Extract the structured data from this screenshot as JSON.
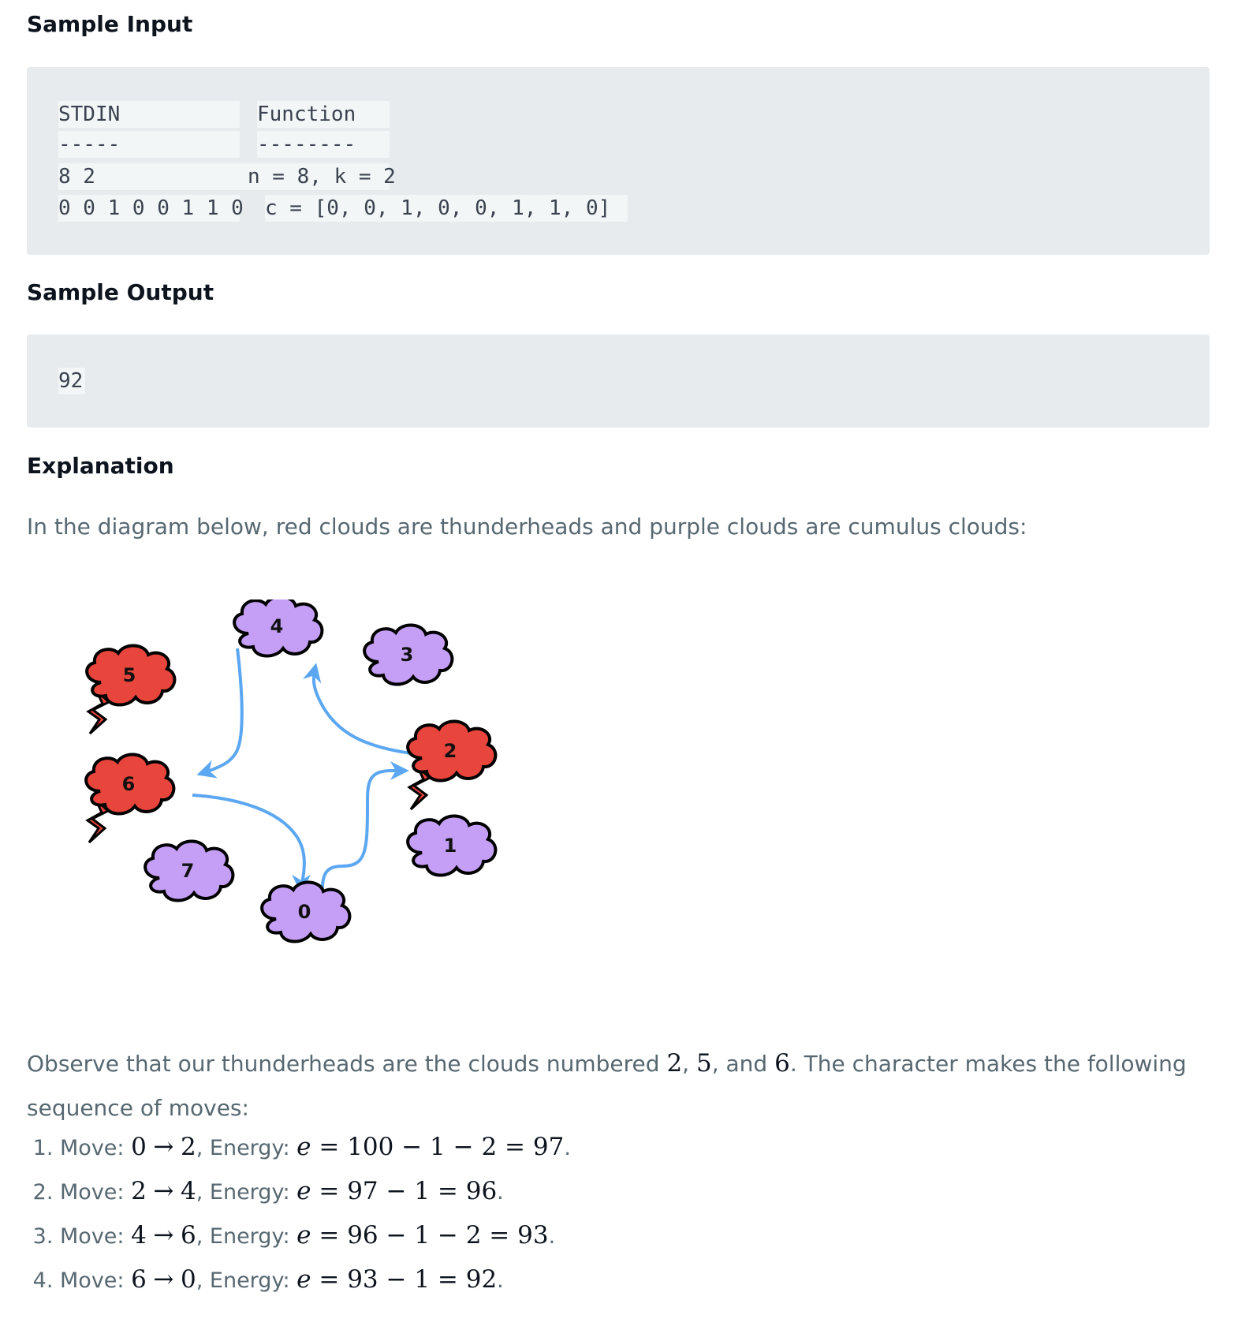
{
  "sample_input": {
    "heading": "Sample Input",
    "header": [
      "STDIN",
      "Function"
    ],
    "divider": [
      "-----",
      "--------"
    ],
    "rows": [
      [
        "8 2",
        "n = 8, k = 2"
      ],
      [
        "0 0 1 0 0 1 1 0",
        "c = [0, 0, 1, 0, 0, 1, 1, 0]"
      ]
    ]
  },
  "sample_output": {
    "heading": "Sample Output",
    "value": "92"
  },
  "explanation": {
    "heading": "Explanation",
    "intro": "In the diagram below, red clouds are thunderheads and purple clouds are cumulus clouds:",
    "observe_1": "Observe that our thunderheads are the clouds numbered ",
    "observe_n1": "2",
    "observe_sep1": ", ",
    "observe_n2": "5",
    "observe_sep2": ", and ",
    "observe_n3": "6",
    "observe_2": ". The character makes the following sequence of moves:",
    "moves": [
      {
        "prefix": "Move: ",
        "from": "0",
        "to": "2",
        "energy_label": ", Energy: ",
        "expr": "100 − 1 − 2 = 97",
        "end": "."
      },
      {
        "prefix": "Move: ",
        "from": "2",
        "to": "4",
        "energy_label": ", Energy: ",
        "expr": "97 − 1 = 96",
        "end": "."
      },
      {
        "prefix": "Move: ",
        "from": "4",
        "to": "6",
        "energy_label": ", Energy: ",
        "expr": "96 − 1 − 2 = 93",
        "end": "."
      },
      {
        "prefix": "Move: ",
        "from": "6",
        "to": "0",
        "energy_label": ", Energy: ",
        "expr": "93 − 1 = 92",
        "end": "."
      }
    ],
    "energy_var": "e",
    "arrow": "→"
  },
  "diagram": {
    "clouds": [
      {
        "label": "0",
        "type": "cumulus"
      },
      {
        "label": "1",
        "type": "cumulus"
      },
      {
        "label": "2",
        "type": "thunderhead"
      },
      {
        "label": "3",
        "type": "cumulus"
      },
      {
        "label": "4",
        "type": "cumulus"
      },
      {
        "label": "5",
        "type": "thunderhead"
      },
      {
        "label": "6",
        "type": "thunderhead"
      },
      {
        "label": "7",
        "type": "cumulus"
      }
    ],
    "colors": {
      "cumulus": "#c59ff5",
      "thunderhead": "#e8453c",
      "arrow": "#5ba7f2",
      "outline": "#000000"
    }
  }
}
